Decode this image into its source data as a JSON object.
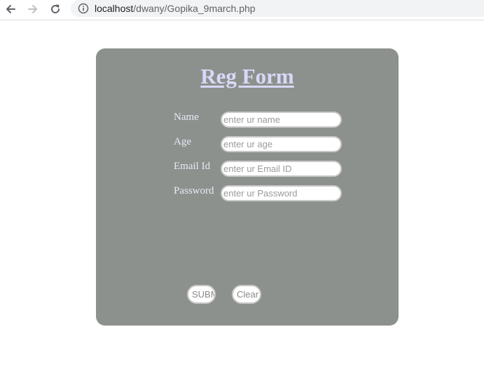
{
  "browser": {
    "url_host": "localhost",
    "url_path": "/dwany/Gopika_9march.php"
  },
  "form": {
    "title": "Reg Form",
    "fields": [
      {
        "label": "Name",
        "placeholder": "enter ur name"
      },
      {
        "label": "Age",
        "placeholder": "enter ur age"
      },
      {
        "label": "Email Id",
        "placeholder": "enter ur Email ID"
      },
      {
        "label": "Password",
        "placeholder": "enter ur Password"
      }
    ],
    "submit_label": "SUBMIT",
    "clear_label": "Clear"
  }
}
